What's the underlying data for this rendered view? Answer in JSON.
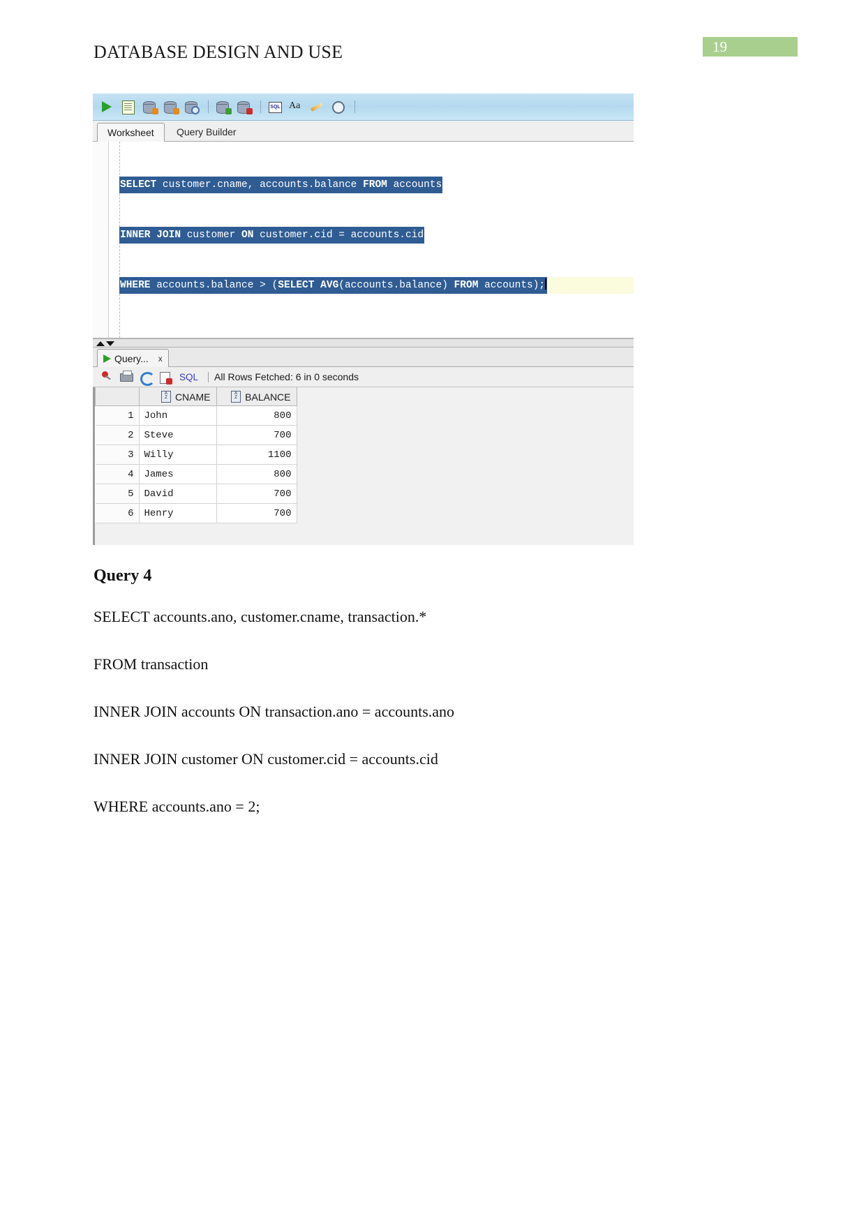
{
  "document": {
    "title": "DATABASE DESIGN AND USE",
    "page_number": "19"
  },
  "screenshot": {
    "toolbar": {
      "icons": [
        {
          "name": "run-statement-icon",
          "label": "Run Statement"
        },
        {
          "name": "run-script-icon",
          "label": "Run Script"
        },
        {
          "name": "explain-plan-icon",
          "label": "Explain Plan"
        },
        {
          "name": "autotrace-icon",
          "label": "Autotrace"
        },
        {
          "name": "sql-tuning-advisor-icon",
          "label": "SQL Tuning Advisor"
        },
        {
          "name": "commit-icon",
          "label": "Commit"
        },
        {
          "name": "rollback-icon",
          "label": "Rollback"
        },
        {
          "name": "unshared-sql-worksheet-icon",
          "label": "Unshared SQL Worksheet"
        },
        {
          "name": "format-text-icon",
          "label": "Aa"
        },
        {
          "name": "clear-worksheet-icon",
          "label": "Clear"
        },
        {
          "name": "query-history-icon",
          "label": "SQL History"
        }
      ]
    },
    "tabs": [
      {
        "name": "worksheet",
        "label": "Worksheet",
        "active": true
      },
      {
        "name": "query-builder",
        "label": "Query Builder",
        "active": false
      }
    ],
    "editor": {
      "lines": [
        {
          "segments": [
            {
              "text": "SELECT",
              "bold": true
            },
            {
              "text": " customer.cname, accounts.balance ",
              "bold": false
            },
            {
              "text": "FROM",
              "bold": true
            },
            {
              "text": " accounts",
              "bold": false
            }
          ]
        },
        {
          "segments": [
            {
              "text": "INNER JOIN",
              "bold": true
            },
            {
              "text": " customer ",
              "bold": false
            },
            {
              "text": "ON",
              "bold": true
            },
            {
              "text": " customer.cid = accounts.cid",
              "bold": false
            }
          ]
        },
        {
          "segments": [
            {
              "text": "WHERE",
              "bold": true
            },
            {
              "text": " accounts.balance > (",
              "bold": false
            },
            {
              "text": "SELECT AVG",
              "bold": true
            },
            {
              "text": "(accounts.balance) ",
              "bold": false
            },
            {
              "text": "FROM",
              "bold": true
            },
            {
              "text": " accounts);",
              "bold": false
            }
          ]
        }
      ]
    },
    "results": {
      "tab_label": "Query...",
      "tab_close": "x",
      "toolbar": {
        "icons": [
          {
            "name": "pin-icon",
            "label": "Freeze"
          },
          {
            "name": "print-icon",
            "label": "Print"
          },
          {
            "name": "refresh-icon",
            "label": "Refresh"
          },
          {
            "name": "detach-icon",
            "label": "Close Result"
          }
        ],
        "sql_link": "SQL",
        "status": "All Rows Fetched: 6 in 0 seconds"
      },
      "columns": [
        "CNAME",
        "BALANCE"
      ],
      "rows": [
        {
          "num": "1",
          "cname": "John",
          "balance": "800"
        },
        {
          "num": "2",
          "cname": "Steve",
          "balance": "700"
        },
        {
          "num": "3",
          "cname": "Willy",
          "balance": "1100"
        },
        {
          "num": "4",
          "cname": "James",
          "balance": "800"
        },
        {
          "num": "5",
          "cname": "David",
          "balance": "700"
        },
        {
          "num": "6",
          "cname": "Henry",
          "balance": "700"
        }
      ]
    }
  },
  "body": {
    "heading": "Query 4",
    "lines": [
      "SELECT accounts.ano, customer.cname, transaction.*",
      "FROM transaction",
      "INNER JOIN accounts ON transaction.ano = accounts.ano",
      "INNER JOIN customer ON customer.cid = accounts.cid",
      "WHERE accounts.ano = 2;"
    ]
  },
  "colors": {
    "page_badge_bg": "#a8cf8e",
    "editor_selection_bg": "#2f5c93",
    "toolbar_bg": "#bedcf0"
  }
}
